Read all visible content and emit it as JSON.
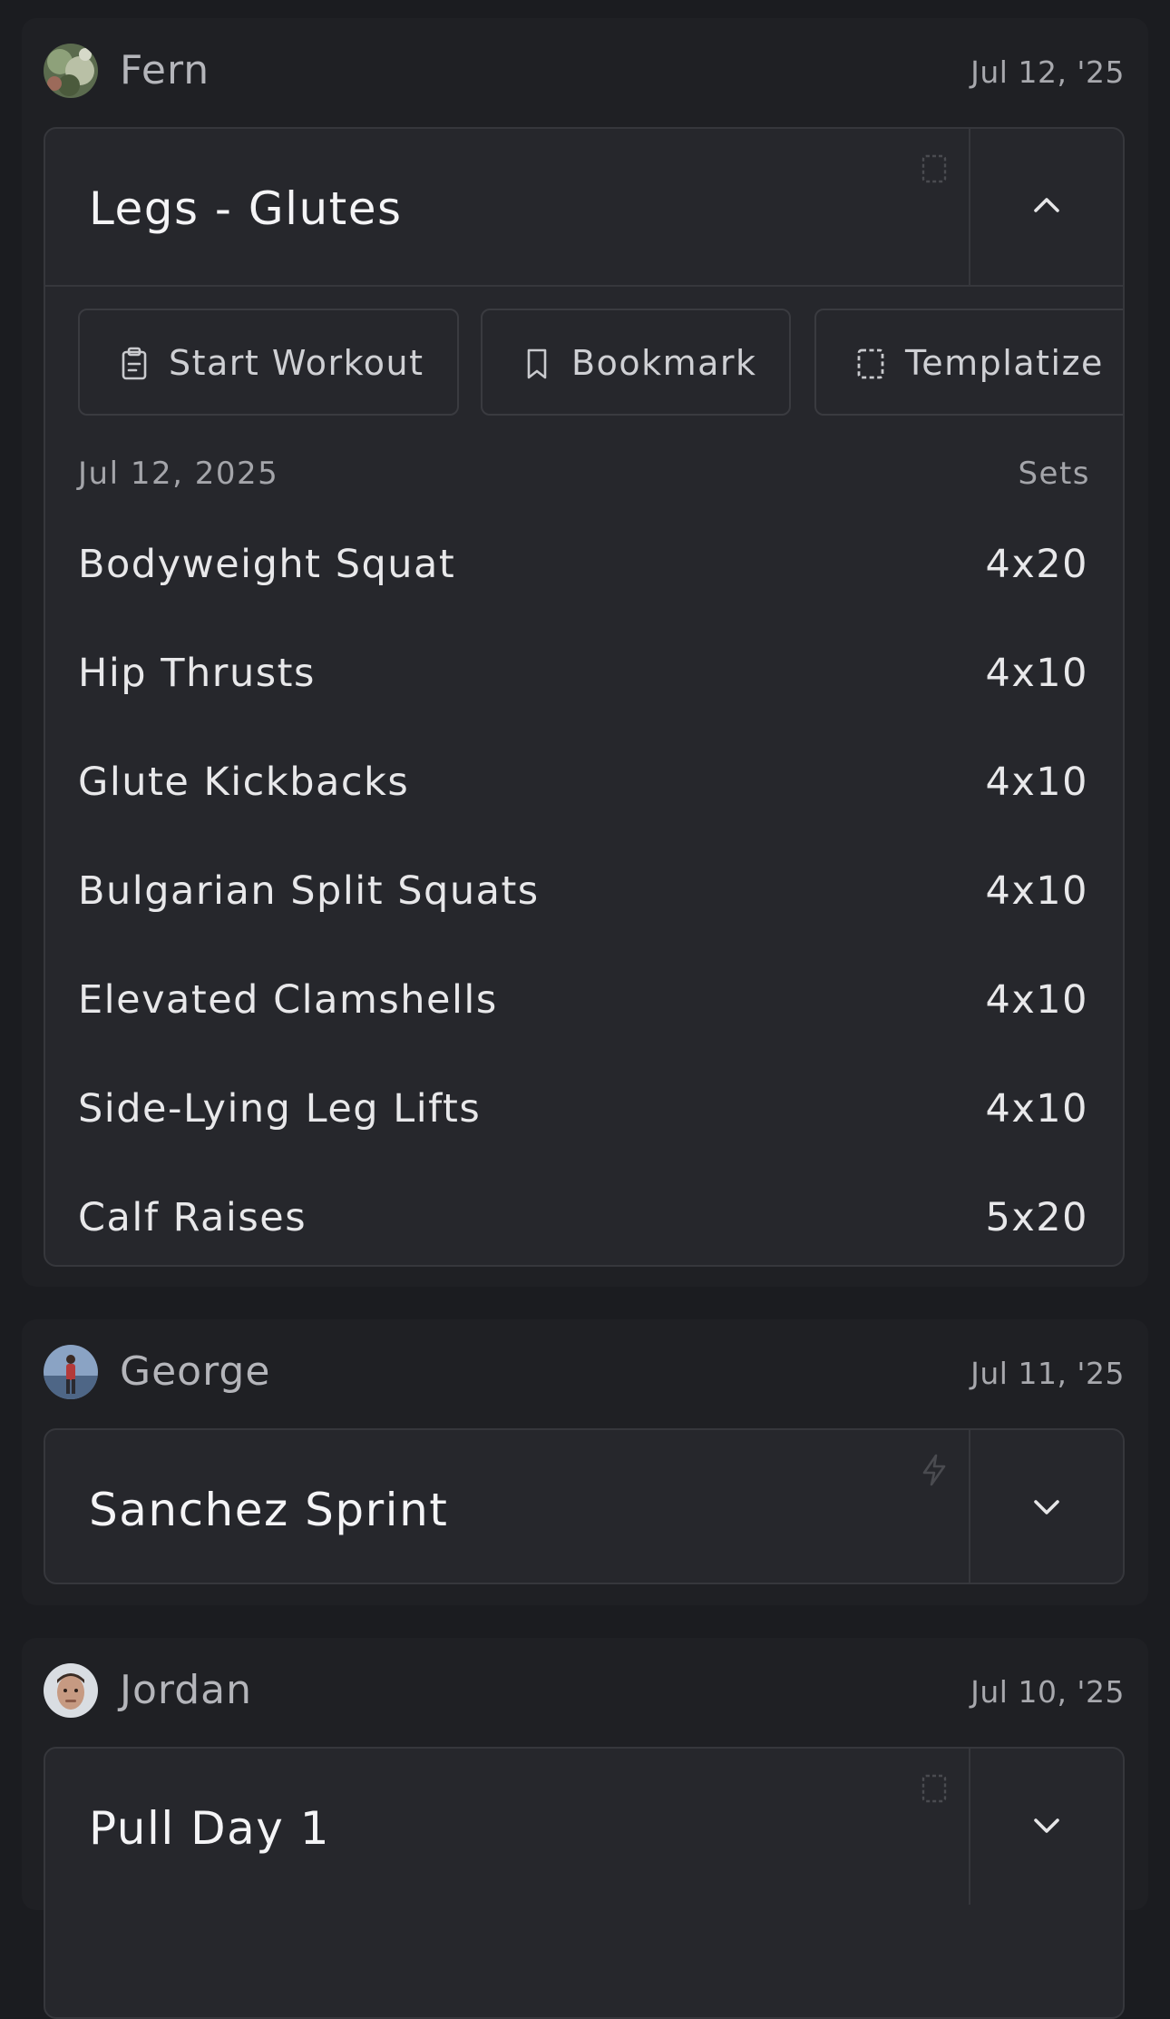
{
  "posts": [
    {
      "user": "Fern",
      "date": "Jul 12, '25",
      "workout": {
        "title": "Legs - Glutes",
        "type_icon": "template-icon",
        "toggle_icon": "chevron-up-icon",
        "expanded": true,
        "actions": [
          {
            "label": "Start Workout",
            "icon": "clipboard-icon"
          },
          {
            "label": "Bookmark",
            "icon": "bookmark-icon"
          },
          {
            "label": "Templatize",
            "icon": "template-icon"
          }
        ],
        "list_date": "Jul 12, 2025",
        "sets_header": "Sets",
        "exercises": [
          {
            "name": "Bodyweight Squat",
            "sets": "4x20"
          },
          {
            "name": "Hip Thrusts",
            "sets": "4x10"
          },
          {
            "name": "Glute Kickbacks",
            "sets": "4x10"
          },
          {
            "name": "Bulgarian Split Squats",
            "sets": "4x10"
          },
          {
            "name": "Elevated Clamshells",
            "sets": "4x10"
          },
          {
            "name": "Side-Lying Leg Lifts",
            "sets": "4x10"
          },
          {
            "name": "Calf Raises",
            "sets": "5x20"
          }
        ]
      }
    },
    {
      "user": "George",
      "date": "Jul 11, '25",
      "workout": {
        "title": "Sanchez Sprint",
        "type_icon": "lightning-icon",
        "toggle_icon": "chevron-down-icon",
        "expanded": false
      }
    },
    {
      "user": "Jordan",
      "date": "Jul 10, '25",
      "workout": {
        "title": "Pull Day 1",
        "type_icon": "template-icon",
        "toggle_icon": "chevron-down-icon",
        "expanded": false
      }
    }
  ],
  "colors": {
    "page_bg": "#1b1c20",
    "post_bg": "#1f2024",
    "card_bg": "#26272c",
    "border": "#36373c",
    "text_primary": "#f4f4f6",
    "text_muted": "#a7a8ad"
  }
}
